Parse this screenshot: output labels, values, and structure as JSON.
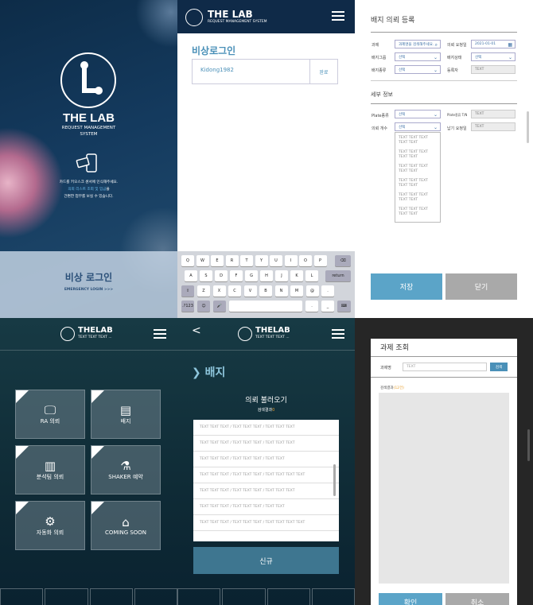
{
  "intro": {
    "logo_title": "THE LAB",
    "logo_sub1": "REQUEST MANAGEMENT",
    "logo_sub2": "SYSTEM",
    "msg_line1": "카드를 키오스크 센서에 인식해주세요.",
    "msg_line2_hl": "의뢰 리스트 조회 및 입금",
    "msg_line2_rest": "을",
    "msg_line3": "간편한 업무를 보실 수 있습니다.",
    "emergency_title": "비상 로그인",
    "emergency_sub": "EMERGENCY LOGIN >>>"
  },
  "login": {
    "header_title": "THE LAB",
    "header_sub": "REQUEST MANAGEMENT SYSTEM",
    "title": "비상로그인",
    "input_value": "Kidong1982",
    "confirm": "완료",
    "keys_row1": [
      "Q",
      "W",
      "E",
      "R",
      "T",
      "Y",
      "U",
      "I",
      "O",
      "P"
    ],
    "keys_row2": [
      "A",
      "S",
      "D",
      "F",
      "G",
      "H",
      "J",
      "K",
      "L"
    ],
    "keys_row3": [
      "Z",
      "X",
      "C",
      "V",
      "B",
      "N",
      "M",
      "@",
      "."
    ],
    "key_return": "return",
    "key_num": ".?123",
    "key_dot": ".",
    "key_dash": "_"
  },
  "badge_reg": {
    "title": "배지 의뢰 등록",
    "f_task": "과제",
    "v_task": "과제명을 검색해주세요.",
    "f_date": "의뢰 요청일",
    "v_date": "2021-01-01",
    "f_group": "배지그룹",
    "v_group": "선택",
    "f_status": "배지상태",
    "v_status": "선택",
    "f_type": "배지종류",
    "v_type": "선택",
    "f_reg": "등록자",
    "v_reg": "TEXT",
    "detail": "세부 정보",
    "f_plate": "Plate종류",
    "v_plate": "선택",
    "f_plate_ea": "Plate종류 T/N",
    "v_plate_ea": "TEXT",
    "f_count": "의뢰 개수",
    "v_count": "선택",
    "f_deadline": "납기 요청일",
    "v_deadline": "TEXT",
    "options": [
      "TEXT TEXT TEXT",
      "TEXT TEXT",
      "TEXT TEXT TEXT",
      "TEXT TEXT",
      "TEXT TEXT TEXT",
      "TEXT TEXT",
      "TEXT TEXT TEXT",
      "TEXT TEXT",
      "TEXT TEXT TEXT",
      "TEXT TEXT",
      "TEXT TEXT TEXT",
      "TEXT TEXT"
    ],
    "save": "저장",
    "close": "닫기"
  },
  "menu": {
    "header_title": "THELAB",
    "header_sub": "TEXT TEXT TEXT ...",
    "tiles": [
      {
        "label": "RA 의뢰"
      },
      {
        "label": "배지"
      },
      {
        "label": "분석팀 의뢰"
      },
      {
        "label": "SHAKER 예약"
      },
      {
        "label": "자동화 의뢰"
      },
      {
        "label": "COMING SOON"
      }
    ]
  },
  "badge_list": {
    "back": "<",
    "header_title": "THELAB",
    "header_sub": "TEXT TEXT TEXT ...",
    "section": "배지",
    "section_arrow": "❯",
    "load_title": "의뢰 불러오기",
    "result_label": "검색결과",
    "result_count": "0",
    "rows": [
      "TEXT TEXT TEXT / TEXT TEXT TEXT / TEXT TEXT TEXT",
      "TEXT TEXT TEXT / TEXT TEXT TEXT / TEXT TEXT TEXT",
      "TEXT TEXT TEXT / TEXT TEXT TEXT / TEXT TEXT",
      "TEXT TEXT TEXT / TEXT TEXT TEXT / TEXT TEXT TEXT TEXT",
      "TEXT TEXT TEXT / TEXT TEXT TEXT / TEXT TEXT TEXT",
      "TEXT TEXT TEXT / TEXT TEXT TEXT / TEXT TEXT",
      "TEXT TEXT TEXT / TEXT TEXT TEXT / TEXT TEXT TEXT TEXT"
    ],
    "new_btn": "신규"
  },
  "task_search": {
    "title": "과제 조회",
    "field_label": "과제명",
    "placeholder": "TEXT",
    "search_btn": "검색",
    "result_label": "검색결과",
    "result_count": "(12건)",
    "ok": "확인",
    "cancel": "취소"
  },
  "colors": {
    "accent": "#4a90b8",
    "blue_btn": "#5ba4c8",
    "gray_btn": "#a9a9a9",
    "teal_btn": "#3e7690"
  }
}
